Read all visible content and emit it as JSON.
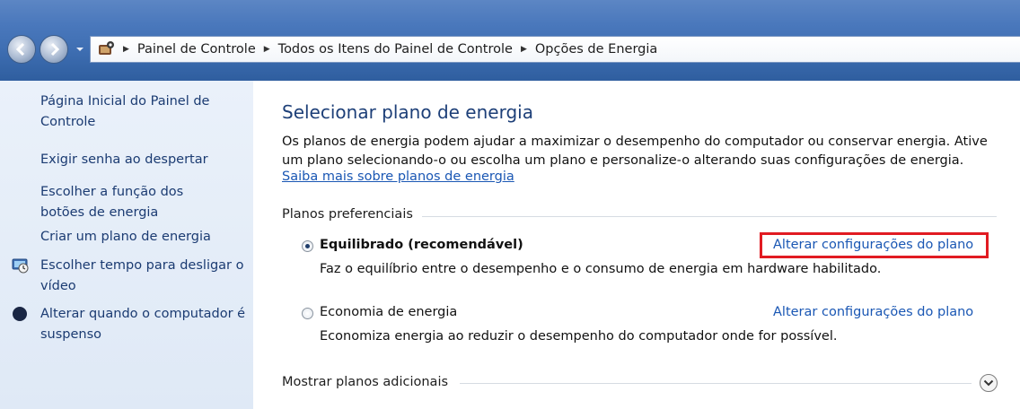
{
  "address_bar": {
    "icon": "control-panel-icon",
    "breadcrumbs": [
      "Painel de Controle",
      "Todos os Itens do Painel de Controle",
      "Opções de Energia"
    ]
  },
  "sidebar": {
    "home_label": "Página Inicial do Painel de Controle",
    "items": [
      {
        "label": "Exigir senha ao despertar",
        "icon": ""
      },
      {
        "label": "Escolher a função dos botões de energia",
        "icon": ""
      },
      {
        "label": "Criar um plano de energia",
        "icon": ""
      },
      {
        "label": "Escolher tempo para desligar o vídeo",
        "icon": "monitor-icon"
      },
      {
        "label": "Alterar quando o computador é suspenso",
        "icon": "moon-icon"
      }
    ]
  },
  "main": {
    "title": "Selecionar plano de energia",
    "description": "Os planos de energia podem ajudar a maximizar o desempenho do computador ou conservar energia. Ative um plano selecionando-o ou escolha um plano e personalize-o alterando suas configurações de energia.",
    "learn_more": "Saiba mais sobre planos de energia",
    "section_title": "Planos preferenciais",
    "plans": [
      {
        "name": "Equilibrado (recomendável)",
        "selected": true,
        "description": "Faz o equilíbrio entre o desempenho e o consumo de energia em hardware habilitado.",
        "link": "Alterar configurações do plano"
      },
      {
        "name": "Economia de energia",
        "selected": false,
        "description": "Economiza energia ao reduzir o desempenho do computador onde for possível.",
        "link": "Alterar configurações do plano"
      }
    ],
    "show_more": "Mostrar planos adicionais"
  },
  "colors": {
    "highlight_box": "#e11b22",
    "link": "#1a57b4",
    "title": "#1d3f78",
    "sidebar_bg": "#e4edf8"
  }
}
